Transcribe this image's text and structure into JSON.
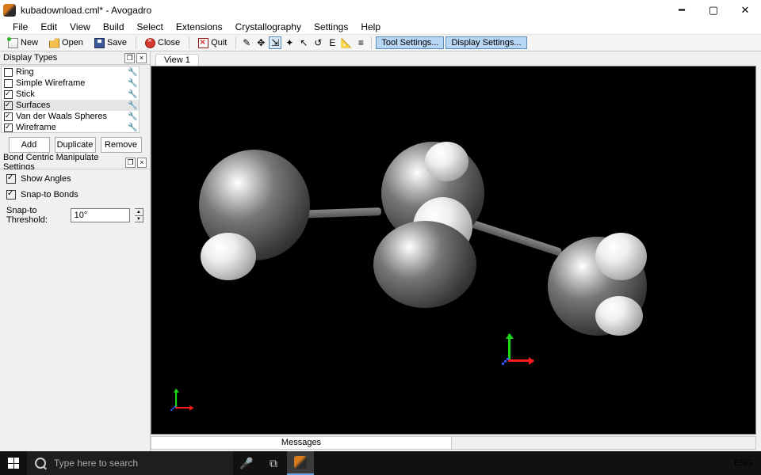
{
  "title": "kubadownload.cml* - Avogadro",
  "menu": [
    "File",
    "Edit",
    "View",
    "Build",
    "Select",
    "Extensions",
    "Crystallography",
    "Settings",
    "Help"
  ],
  "toolbar": {
    "new": "New",
    "open": "Open",
    "save": "Save",
    "close": "Close",
    "quit": "Quit",
    "tool_settings": "Tool Settings...",
    "display_settings": "Display Settings..."
  },
  "panels": {
    "display_types": {
      "title": "Display Types",
      "items": [
        {
          "label": "Ring",
          "checked": false
        },
        {
          "label": "Simple Wireframe",
          "checked": false
        },
        {
          "label": "Stick",
          "checked": true
        },
        {
          "label": "Surfaces",
          "checked": true,
          "selected": true
        },
        {
          "label": "Van der Waals Spheres",
          "checked": true
        },
        {
          "label": "Wireframe",
          "checked": true
        }
      ],
      "buttons": {
        "add": "Add",
        "duplicate": "Duplicate",
        "remove": "Remove"
      }
    },
    "bond_centric": {
      "title": "Bond Centric Manipulate Settings",
      "show_angles": {
        "label": "Show Angles",
        "checked": true
      },
      "snap_to_bonds": {
        "label": "Snap-to Bonds",
        "checked": true
      },
      "snap_threshold": {
        "label": "Snap-to Threshold:",
        "value": "10°"
      }
    }
  },
  "view": {
    "tab": "View 1"
  },
  "messages": {
    "tab": "Messages"
  },
  "taskbar": {
    "search_placeholder": "Type here to search",
    "lang": "ENG"
  }
}
